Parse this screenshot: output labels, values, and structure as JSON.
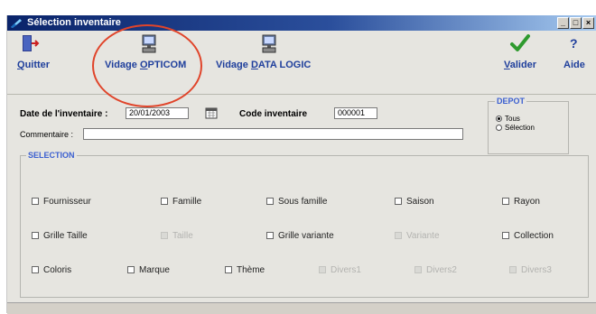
{
  "window": {
    "title": "Sélection inventaire"
  },
  "toolbar": {
    "quit": {
      "label_u": "Q",
      "label_rest": "uitter"
    },
    "vidage_opticom": {
      "label_pre": "Vidage ",
      "label_u": "O",
      "label_rest": "PTICOM"
    },
    "vidage_datalogic": {
      "label_pre": "Vidage ",
      "label_u": "D",
      "label_rest": "ATA LOGIC"
    },
    "valider": {
      "label_u": "V",
      "label_rest": "alider"
    },
    "aide": {
      "icon_text": "?",
      "label": "Aide"
    }
  },
  "form": {
    "date_label": "Date de l'inventaire :",
    "date_value": "20/01/2003",
    "code_label": "Code inventaire",
    "code_value": "000001",
    "comment_label": "Commentaire :",
    "comment_value": ""
  },
  "depot": {
    "title": "DEPOT",
    "options": [
      {
        "label": "Tous",
        "selected": true
      },
      {
        "label": "Sélection",
        "selected": false
      }
    ]
  },
  "selection": {
    "title": "SELECTION",
    "row1": [
      "Fournisseur",
      "Famille",
      "Sous famille",
      "Saison",
      "Rayon"
    ],
    "row2": [
      "Grille Taille",
      "Taille",
      "Grille variante",
      "Variante",
      "Collection"
    ],
    "row3": [
      "Coloris",
      "Marque",
      "Thème",
      "Divers1",
      "Divers2",
      "Divers3"
    ]
  },
  "colors": {
    "accent_text": "#1f3f9c",
    "group_title": "#3b5fd0",
    "highlight": "#e0442a"
  }
}
